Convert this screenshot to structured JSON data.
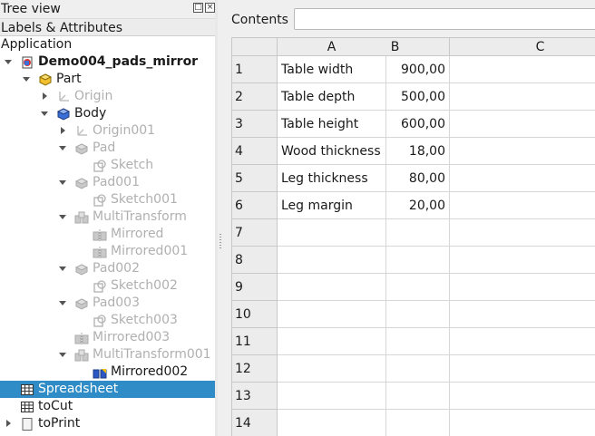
{
  "tree_panel": {
    "title": "Tree view",
    "header": "Labels & Attributes",
    "rows": [
      {
        "label": "Application",
        "depth": 0,
        "arrow": "",
        "icon": "",
        "style": ""
      },
      {
        "label": "Demo004_pads_mirror",
        "depth": 1,
        "arrow": "down",
        "icon": "document-icon",
        "style": "bold"
      },
      {
        "label": "Part",
        "depth": 2,
        "arrow": "down",
        "icon": "part-icon",
        "style": ""
      },
      {
        "label": "Origin",
        "depth": 3,
        "arrow": "right",
        "icon": "origin-icon",
        "style": "dim"
      },
      {
        "label": "Body",
        "depth": 3,
        "arrow": "down",
        "icon": "body-icon",
        "style": ""
      },
      {
        "label": "Origin001",
        "depth": 4,
        "arrow": "right",
        "icon": "origin-icon",
        "style": "dim"
      },
      {
        "label": "Pad",
        "depth": 4,
        "arrow": "down",
        "icon": "pad-icon",
        "style": "dim"
      },
      {
        "label": "Sketch",
        "depth": 5,
        "arrow": "",
        "icon": "sketch-icon",
        "style": "dim"
      },
      {
        "label": "Pad001",
        "depth": 4,
        "arrow": "down",
        "icon": "pad-icon",
        "style": "dim"
      },
      {
        "label": "Sketch001",
        "depth": 5,
        "arrow": "",
        "icon": "sketch-icon",
        "style": "dim"
      },
      {
        "label": "MultiTransform",
        "depth": 4,
        "arrow": "down",
        "icon": "multitransform-icon",
        "style": "dim"
      },
      {
        "label": "Mirrored",
        "depth": 5,
        "arrow": "",
        "icon": "mirrored-icon",
        "style": "dim"
      },
      {
        "label": "Mirrored001",
        "depth": 5,
        "arrow": "",
        "icon": "mirrored-icon",
        "style": "dim"
      },
      {
        "label": "Pad002",
        "depth": 4,
        "arrow": "down",
        "icon": "pad-icon",
        "style": "dim"
      },
      {
        "label": "Sketch002",
        "depth": 5,
        "arrow": "",
        "icon": "sketch-icon",
        "style": "dim"
      },
      {
        "label": "Pad003",
        "depth": 4,
        "arrow": "down",
        "icon": "pad-icon",
        "style": "dim"
      },
      {
        "label": "Sketch003",
        "depth": 5,
        "arrow": "",
        "icon": "sketch-icon",
        "style": "dim"
      },
      {
        "label": "Mirrored003",
        "depth": 4,
        "arrow": "",
        "icon": "mirrored-icon",
        "style": "dim"
      },
      {
        "label": "MultiTransform001",
        "depth": 4,
        "arrow": "down",
        "icon": "multitransform-icon",
        "style": "dim"
      },
      {
        "label": "Mirrored002",
        "depth": 5,
        "arrow": "",
        "icon": "mirrored-tip-icon",
        "style": ""
      },
      {
        "label": "Spreadsheet",
        "depth": 1,
        "arrow": "",
        "icon": "spreadsheet-icon",
        "style": "selected"
      },
      {
        "label": "toCut",
        "depth": 1,
        "arrow": "",
        "icon": "spreadsheet-icon",
        "style": ""
      },
      {
        "label": "toPrint",
        "depth": 1,
        "arrow": "right",
        "icon": "page-icon",
        "style": ""
      }
    ]
  },
  "spreadsheet": {
    "contents_label": "Contents",
    "contents_value": "",
    "columns": [
      "A",
      "B",
      "C"
    ],
    "rows": [
      {
        "num": "1",
        "a": "Table width",
        "b": "900,00",
        "c": ""
      },
      {
        "num": "2",
        "a": "Table depth",
        "b": "500,00",
        "c": ""
      },
      {
        "num": "3",
        "a": "Table height",
        "b": "600,00",
        "c": ""
      },
      {
        "num": "4",
        "a": "Wood thickness",
        "b": "18,00",
        "c": ""
      },
      {
        "num": "5",
        "a": "Leg thickness",
        "b": "80,00",
        "c": ""
      },
      {
        "num": "6",
        "a": "Leg margin",
        "b": "20,00",
        "c": ""
      },
      {
        "num": "7",
        "a": "",
        "b": "",
        "c": ""
      },
      {
        "num": "8",
        "a": "",
        "b": "",
        "c": ""
      },
      {
        "num": "9",
        "a": "",
        "b": "",
        "c": ""
      },
      {
        "num": "10",
        "a": "",
        "b": "",
        "c": ""
      },
      {
        "num": "11",
        "a": "",
        "b": "",
        "c": ""
      },
      {
        "num": "12",
        "a": "",
        "b": "",
        "c": ""
      },
      {
        "num": "13",
        "a": "",
        "b": "",
        "c": ""
      },
      {
        "num": "14",
        "a": "",
        "b": "",
        "c": ""
      }
    ]
  },
  "colors": {
    "selection": "#308cc6",
    "dim_text": "#b0b0b0"
  }
}
